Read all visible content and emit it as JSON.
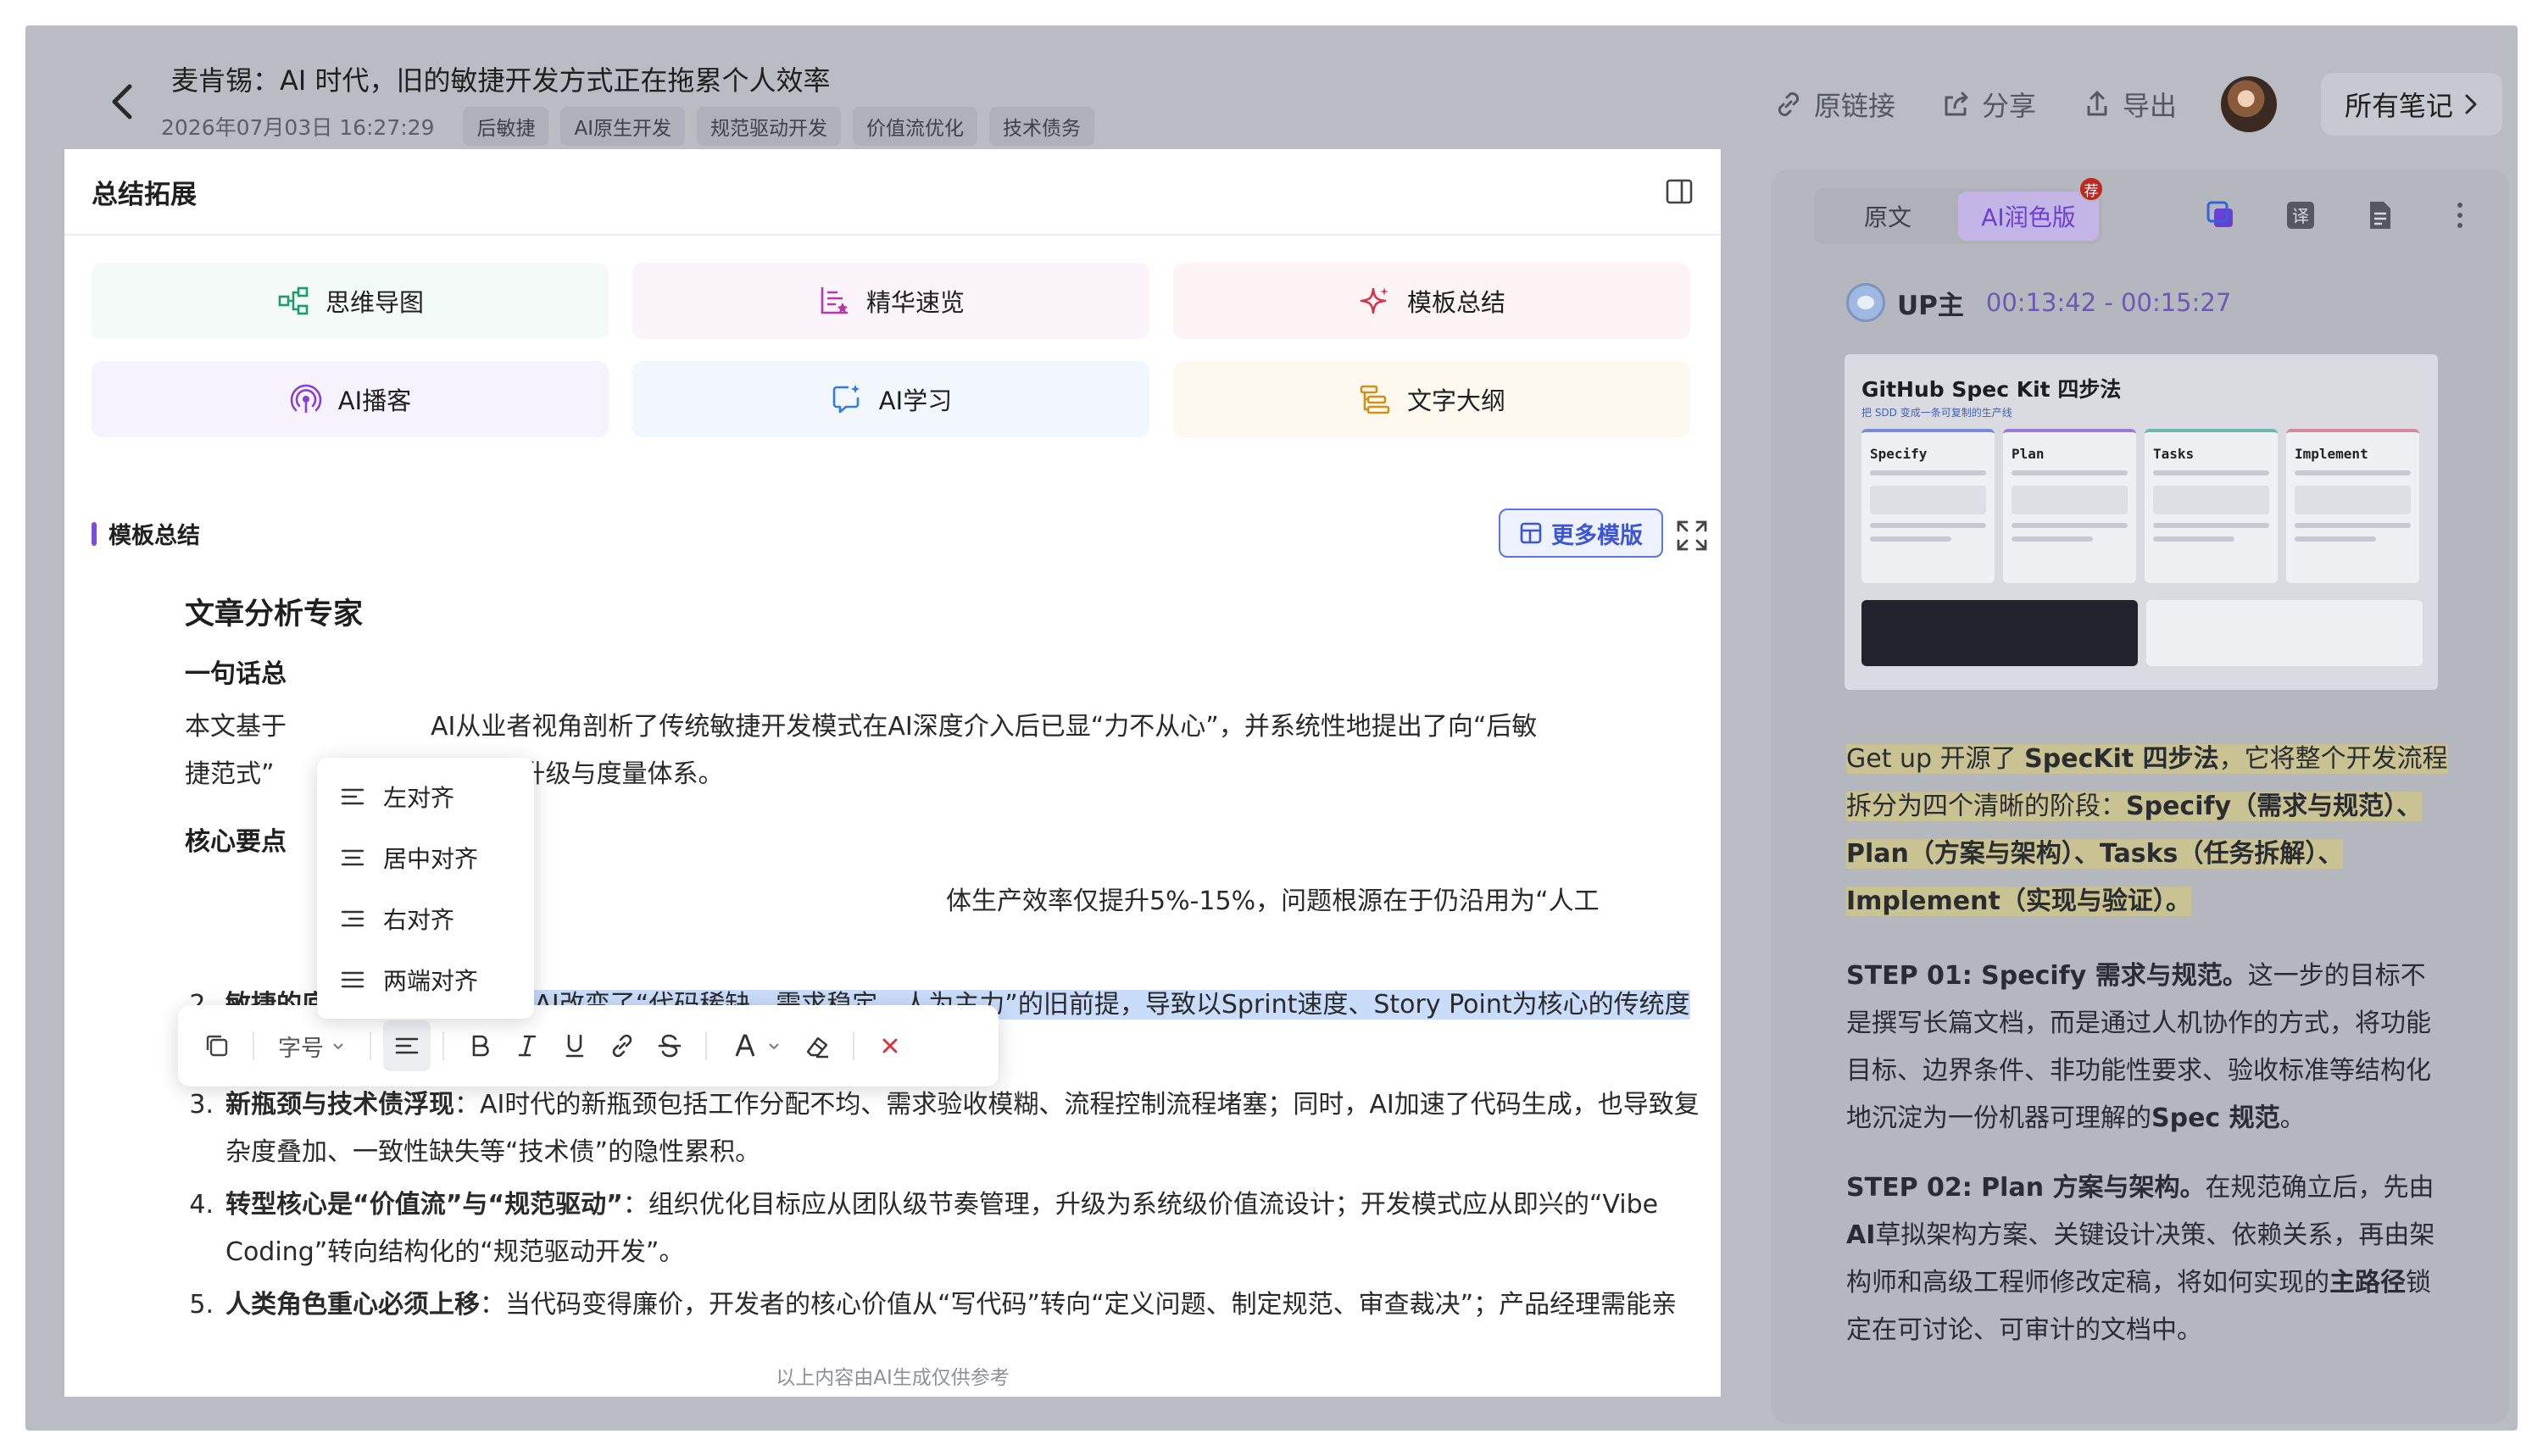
{
  "header": {
    "title": "麦肯锡：AI 时代，旧的敏捷开发方式正在拖累个人效率",
    "date": "2026年07月03日 16:27:29",
    "tags": [
      "后敏捷",
      "AI原生开发",
      "规范驱动开发",
      "价值流优化",
      "技术债务"
    ],
    "actions": {
      "original_link": "原链接",
      "share": "分享",
      "export": "导出",
      "all_notes": "所有笔记"
    }
  },
  "left_panel": {
    "title": "总结拓展",
    "features": [
      {
        "label": "思维导图",
        "icon": "mindmap-icon"
      },
      {
        "label": "精华速览",
        "icon": "highlights-icon"
      },
      {
        "label": "模板总结",
        "icon": "sparkle-icon"
      },
      {
        "label": "AI播客",
        "icon": "podcast-icon"
      },
      {
        "label": "AI学习",
        "icon": "ai-learn-icon"
      },
      {
        "label": "文字大纲",
        "icon": "outline-icon"
      }
    ],
    "section_title": "模板总结",
    "more_templates": "更多模版",
    "doc": {
      "h1": "文章分析专家",
      "one_line_label": "一句话总",
      "para_start": "本文基于",
      "para_mid": "AI从业者视角剖析了传统敏捷开发模式在AI深度介入后已显“力不从心”，并系统性地提出了向“后敏",
      "para_l2a": "捷范式”",
      "para_l2b": "论、角色升级与度量体系。",
      "key_points_label": "核心要点",
      "item1_tail": "体生产效率仅提升5%-15%，问题根源在于仍沿用为“人工",
      "items": [
        {
          "num": "2.",
          "bold": "敏捷的底层假设被AI颠覆",
          "text": "AI改变了“代码稀缺、需求稳定、人为主力”的旧前提，导致以Sprint速度、Story Point为核心的传统度量方式失效。"
        },
        {
          "num": "3.",
          "bold": "新瓶颈与技术债浮现",
          "text": "AI时代的新瓶颈包括工作分配不均、需求验收模糊、流程控制流程堵塞；同时，AI加速了代码生成，也导致复杂度叠加、一致性缺失等“技术债”的隐性累积。"
        },
        {
          "num": "4.",
          "bold": "转型核心是“价值流”与“规范驱动”",
          "text": "组织优化目标应从团队级节奏管理，升级为系统级价值流设计；开发模式应从即兴的“Vibe Coding”转向结构化的“规范驱动开发”。"
        },
        {
          "num": "5.",
          "bold": "人类角色重心必须上移",
          "text": "当代码变得廉价，开发者的核心价值从“写代码”转向“定义问题、制定规范、审查裁决”；产品经理需能亲手搭建AI原型；架构师需强化显性化规则与自动化治理。"
        }
      ]
    },
    "disclaimer": "以上内容由AI生成仅供参考",
    "align_menu": [
      "左对齐",
      "居中对齐",
      "右对齐",
      "两端对齐"
    ],
    "toolbar": {
      "font_size": "字号"
    }
  },
  "right_panel": {
    "tabs": [
      "原文",
      "AI润色版"
    ],
    "badge": "荐",
    "uploader": "UP主",
    "time_range": "00:13:42 - 00:15:27",
    "thumb": {
      "title": "GitHub Spec Kit 四步法",
      "subtitle": "把 SDD 变成一条可复制的生产线",
      "steps": [
        "Specify",
        "Plan",
        "Tasks",
        "Implement"
      ]
    },
    "p1": {
      "a": "Get up 开源了 ",
      "b": "SpecKit 四步法",
      "c": "，它将整个开发流程拆分为四个清晰的阶段：",
      "d": "Specify（需求与规范）、Plan（方案与架构）、Tasks（任务拆解）、Implement（实现与验证）。"
    },
    "p2": {
      "a": "STEP 01: Specify 需求与规范。",
      "b": "这一步的目标不是撰写长篇文档，而是通过人机协作的方式，将功能目标、边界条件、非功能性要求、验收标准等结构化地沉淀为一份机器可理解的",
      "c": "Spec 规范",
      "d": "。"
    },
    "p3": {
      "a": "STEP 02: Plan 方案与架构。",
      "b": "在规范确立后，先由",
      "c": "AI",
      "d": "草拟架构方案、关键设计决策、依赖关系，再由架构师和高级工程师修改定稿，将如何实现的",
      "e": "主路径",
      "f": "锁定在可讨论、可审计的文档中。"
    }
  },
  "colors": {
    "accent_purple": "#7a4bdc",
    "accent_blue": "#3c56d6",
    "selection": "#c9dcfa",
    "highlight_yellow": "#c9c394",
    "badge_red": "#c0271f"
  }
}
